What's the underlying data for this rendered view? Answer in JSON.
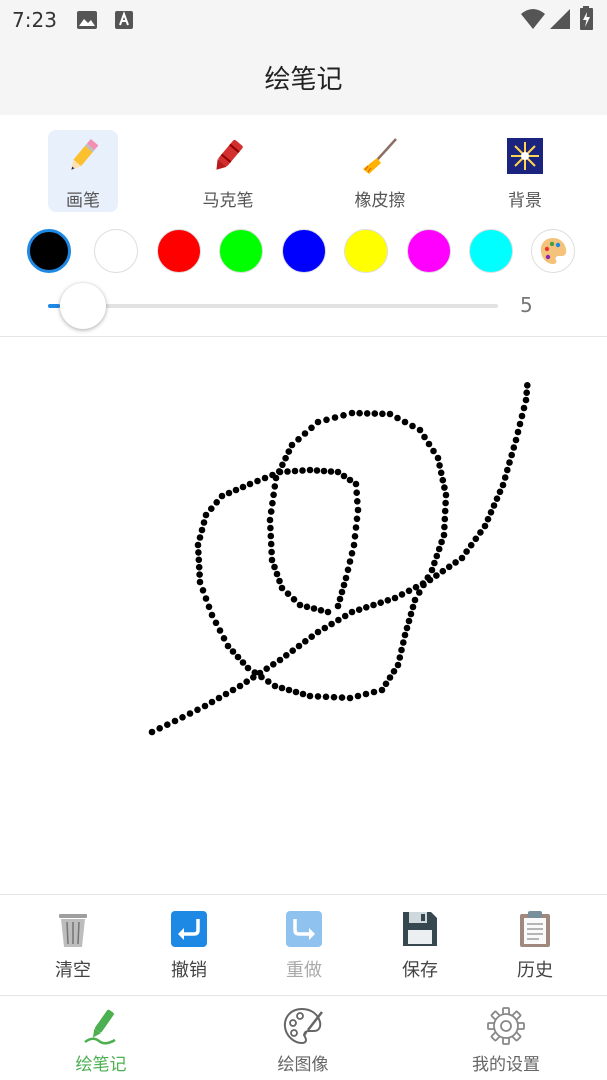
{
  "status_bar": {
    "time": "7:23"
  },
  "app_bar": {
    "title": "绘笔记"
  },
  "tools": [
    {
      "label": "画笔",
      "icon": "pencil-icon",
      "active": true
    },
    {
      "label": "马克笔",
      "icon": "crayon-icon",
      "active": false
    },
    {
      "label": "橡皮擦",
      "icon": "broom-icon",
      "active": false
    },
    {
      "label": "背景",
      "icon": "sparkler-icon",
      "active": false
    }
  ],
  "colors": [
    "#000000",
    "#ffffff",
    "#ff0000",
    "#00ff00",
    "#0000ff",
    "#ffff00",
    "#ff00ff",
    "#00ffff"
  ],
  "selected_color": "#000000",
  "palette_icon": "palette-icon",
  "brush_size": {
    "value": "5",
    "min": 1,
    "max": 50
  },
  "actions": [
    {
      "label": "清空",
      "icon": "trash-icon",
      "enabled": true
    },
    {
      "label": "撤销",
      "icon": "undo-icon",
      "enabled": true
    },
    {
      "label": "重做",
      "icon": "redo-icon",
      "enabled": false
    },
    {
      "label": "保存",
      "icon": "floppy-icon",
      "enabled": true
    },
    {
      "label": "历史",
      "icon": "clipboard-icon",
      "enabled": true
    }
  ],
  "nav": [
    {
      "label": "绘笔记",
      "icon": "pen-icon",
      "active": true
    },
    {
      "label": "绘图像",
      "icon": "palette-icon",
      "active": false
    },
    {
      "label": "我的设置",
      "icon": "gear-icon",
      "active": false
    }
  ],
  "accent_color": "#1e88e5",
  "nav_active_color": "#4caf50"
}
